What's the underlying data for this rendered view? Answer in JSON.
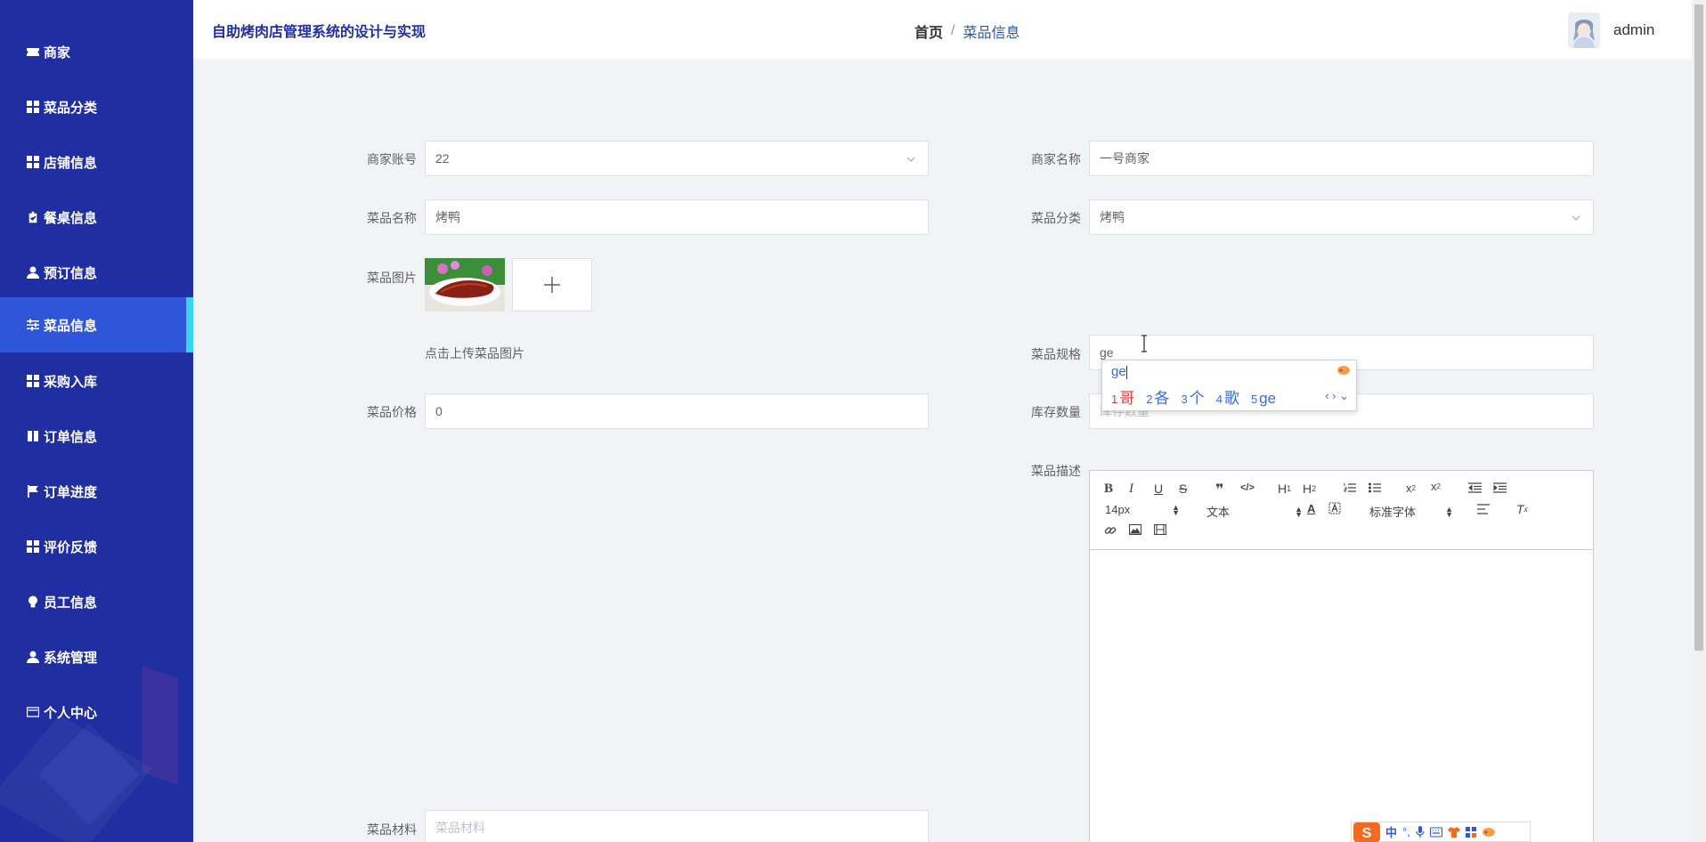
{
  "header": {
    "title": "自助烤肉店管理系统的设计与实现",
    "breadcrumb_home": "首页",
    "breadcrumb_sep": "/",
    "breadcrumb_current": "菜品信息",
    "username": "admin"
  },
  "sidebar": {
    "items": [
      {
        "label": "商家",
        "icon": "ticket-icon"
      },
      {
        "label": "菜品分类",
        "icon": "grid-icon"
      },
      {
        "label": "店铺信息",
        "icon": "grid-icon"
      },
      {
        "label": "餐桌信息",
        "icon": "clipboard-check-icon"
      },
      {
        "label": "预订信息",
        "icon": "user-icon"
      },
      {
        "label": "菜品信息",
        "icon": "sliders-icon",
        "active": true
      },
      {
        "label": "采购入库",
        "icon": "grid-icon"
      },
      {
        "label": "订单信息",
        "icon": "book-icon"
      },
      {
        "label": "订单进度",
        "icon": "flag-icon"
      },
      {
        "label": "评价反馈",
        "icon": "grid-icon"
      },
      {
        "label": "员工信息",
        "icon": "bulb-icon"
      },
      {
        "label": "系统管理",
        "icon": "user-icon"
      },
      {
        "label": "个人中心",
        "icon": "wallet-icon"
      }
    ]
  },
  "form": {
    "merchant_account": {
      "label": "商家账号",
      "value": "22"
    },
    "merchant_name": {
      "label": "商家名称",
      "value": "一号商家"
    },
    "dish_name": {
      "label": "菜品名称",
      "value": "烤鸭"
    },
    "dish_category": {
      "label": "菜品分类",
      "value": "烤鸭"
    },
    "dish_image": {
      "label": "菜品图片",
      "hint": "点击上传菜品图片"
    },
    "dish_spec": {
      "label": "菜品规格",
      "value": "ge"
    },
    "dish_price": {
      "label": "菜品价格",
      "value": "0"
    },
    "stock": {
      "label": "库存数量",
      "placeholder": "库存数量"
    },
    "description": {
      "label": "菜品描述"
    },
    "materials": {
      "label": "菜品材料",
      "placeholder": "菜品材料"
    }
  },
  "ime": {
    "composition": "ge",
    "candidates": [
      {
        "n": "1",
        "text": "哥"
      },
      {
        "n": "2",
        "text": "各"
      },
      {
        "n": "3",
        "text": "个"
      },
      {
        "n": "4",
        "text": "歌"
      },
      {
        "n": "5",
        "text": "ge"
      }
    ],
    "nav": "‹ › ⌄"
  },
  "editor": {
    "font_size": "14px",
    "block_type": "文本",
    "font_family": "标准字体"
  },
  "taskbar_ime": {
    "mode": "中",
    "punct": "°,"
  },
  "colors": {
    "sidebar_bg": "#1f2ea0",
    "sidebar_active": "#2f56d8",
    "active_indicator": "#39d3ef",
    "title": "#1f2ea0",
    "page_bg": "#f1f4f4"
  }
}
